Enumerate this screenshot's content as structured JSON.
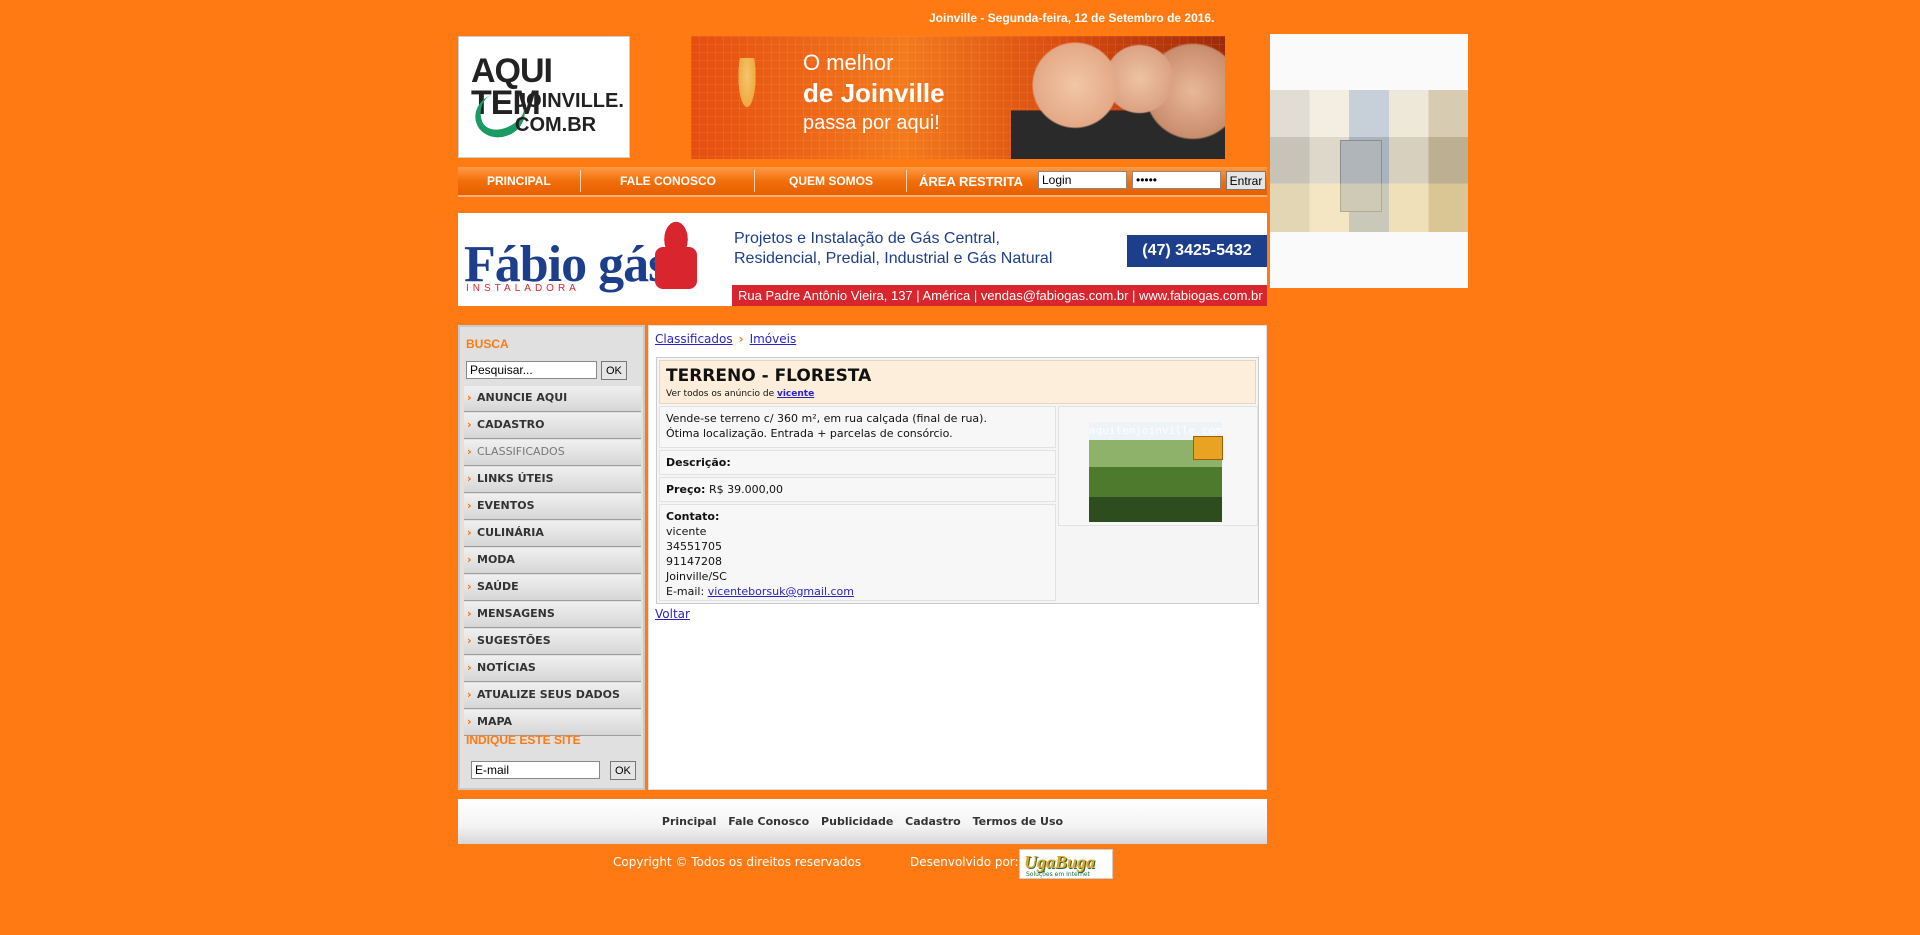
{
  "header": {
    "date_text": "Joinville - Segunda-feira, 12 de Setembro de 2016.",
    "logo": {
      "line1": "AQUI TEM",
      "line2": "JOINVILLE.",
      "line3": "COM.BR"
    },
    "banner": {
      "line1": "O melhor",
      "line2": "de Joinville",
      "line3": "passa por aqui!"
    }
  },
  "nav": {
    "items": [
      "PRINCIPAL",
      "FALE CONOSCO",
      "QUEM SOMOS"
    ],
    "restricted_label": "ÁREA RESTRITA",
    "login_value": "Login",
    "password_value": "•••••",
    "submit_label": "Entrar"
  },
  "ad": {
    "brand": "Fábio gás",
    "brand_sub": "INSTALADORA",
    "desc_line1": "Projetos e Instalação de Gás Central,",
    "desc_line2": "Residencial, Predial, Industrial e Gás Natural",
    "phone": "(47) 3425-5432",
    "address": "Rua Padre Antônio Vieira, 137 | América | vendas@fabiogas.com.br | www.fabiogas.com.br"
  },
  "sidebar": {
    "search_heading": "BUSCA",
    "search_placeholder": "Pesquisar...",
    "ok_label": "OK",
    "menu": [
      "ANUNCIE AQUI",
      "CADASTRO",
      "CLASSIFICADOS",
      "LINKS ÚTEIS",
      "EVENTOS",
      "CULINÁRIA",
      "MODA",
      "SAÚDE",
      "MENSAGENS",
      "SUGESTÕES",
      "NOTÍCIAS",
      "ATUALIZE SEUS DADOS",
      "MAPA"
    ],
    "indique_heading": "INDIQUE ESTE SITE",
    "email_value": "E-mail"
  },
  "content": {
    "breadcrumb": [
      "Classificados",
      "Imóveis"
    ],
    "listing": {
      "title": "TERRENO - FLORESTA",
      "by_prefix": "Ver todos os anúncio de ",
      "by_user": "vicente",
      "summary_line1": "Vende-se terreno c/ 360 m², em rua calçada (final de rua).",
      "summary_line2": "Ótima localização. Entrada + parcelas de consórcio.",
      "descricao_label": "Descrição:",
      "preco_label": "Preço:",
      "preco_value": "R$ 39.000,00",
      "contato_label": "Contato:",
      "contato_name": "vicente",
      "contato_phone1": "34551705",
      "contato_phone2": "91147208",
      "contato_city": "Joinville/SC",
      "email_label": "E-mail: ",
      "email": "vicenteborsuk@gmail.com",
      "photo_watermark": "aquitemjoinville.com.br"
    },
    "back_label": "Voltar"
  },
  "footer": {
    "links": [
      "Principal",
      "Fale Conosco",
      "Publicidade",
      "Cadastro",
      "Termos de Uso"
    ],
    "copyright": "Copyright © Todos os direitos reservados",
    "developed_by": "Desenvolvido por:",
    "dev_logo": "UgaBuga",
    "dev_logo_sub": "Soluções em Internet"
  }
}
